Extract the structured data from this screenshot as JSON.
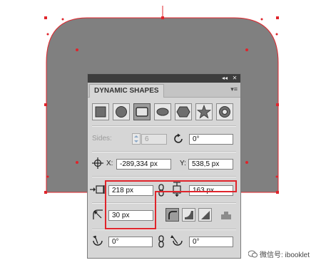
{
  "panel": {
    "title": "DYNAMIC SHAPES",
    "collapse_label": "◂◂",
    "close_label": "✕",
    "menu_label": "▾≡"
  },
  "shapes": [
    {
      "name": "rectangle"
    },
    {
      "name": "ellipse"
    },
    {
      "name": "rounded-rectangle"
    },
    {
      "name": "oval"
    },
    {
      "name": "hexagon"
    },
    {
      "name": "star"
    },
    {
      "name": "donut"
    }
  ],
  "sides": {
    "label": "Sides:",
    "value": "6"
  },
  "rotation": {
    "value": "0°"
  },
  "position": {
    "x_label": "X:",
    "x_value": "-289,334 px",
    "y_label": "Y:",
    "y_value": "538,5 px"
  },
  "size": {
    "width": "218 px",
    "height": "163 px"
  },
  "corner": {
    "radius": "30 px"
  },
  "angles": {
    "start": "0°",
    "end": "0°"
  },
  "watermark": "微信号: ibooklet",
  "colors": {
    "canvas_shape": "#808080",
    "selection": "#e0242b",
    "panel_bg": "#d6d6d6",
    "titlebar": "#3d3d3d"
  }
}
